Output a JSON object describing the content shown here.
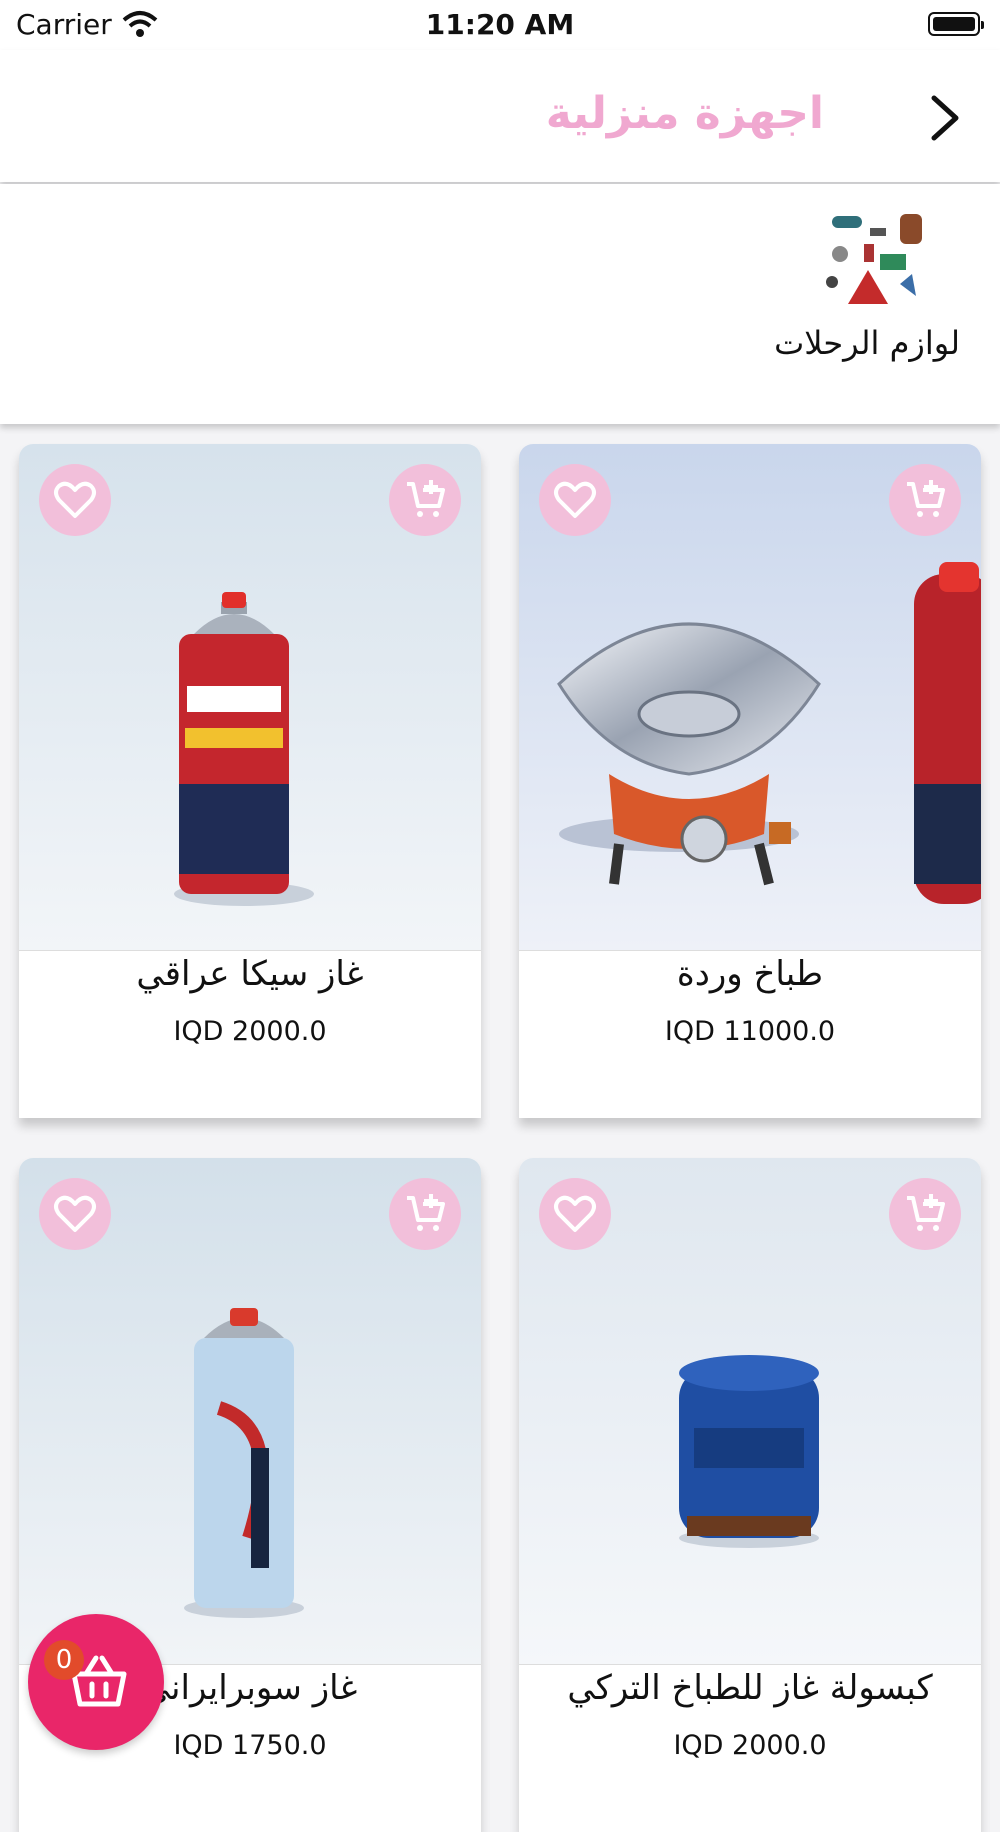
{
  "status_bar": {
    "carrier": "Carrier",
    "time": "11:20 AM"
  },
  "nav": {
    "title": "اجهزة منزلية",
    "back_icon": "chevron-right-icon"
  },
  "categories": [
    {
      "label": "لوازم الرحلات",
      "icon": "camping-gear-image"
    }
  ],
  "products": [
    {
      "name": "طباخ وردة",
      "price": "IQD 11000.0",
      "image": "camping-stove-image"
    },
    {
      "name": "غاز سيكا عراقي",
      "price": "IQD 2000.0",
      "image": "sega-gas-cartridge-image"
    },
    {
      "name": "كبسولة غاز للطباخ التركي",
      "price": "IQD 2000.0",
      "image": "blue-gas-canister-image"
    },
    {
      "name": "غاز سوبرايراني",
      "price": "IQD 1750.0",
      "image": "superfive-gas-can-image"
    }
  ],
  "basket": {
    "count": "0"
  },
  "colors": {
    "accent_pink": "#f0a8d0",
    "button_pink": "#f2bfda",
    "basket_red": "#e92669",
    "badge_red": "#e24b2b"
  }
}
